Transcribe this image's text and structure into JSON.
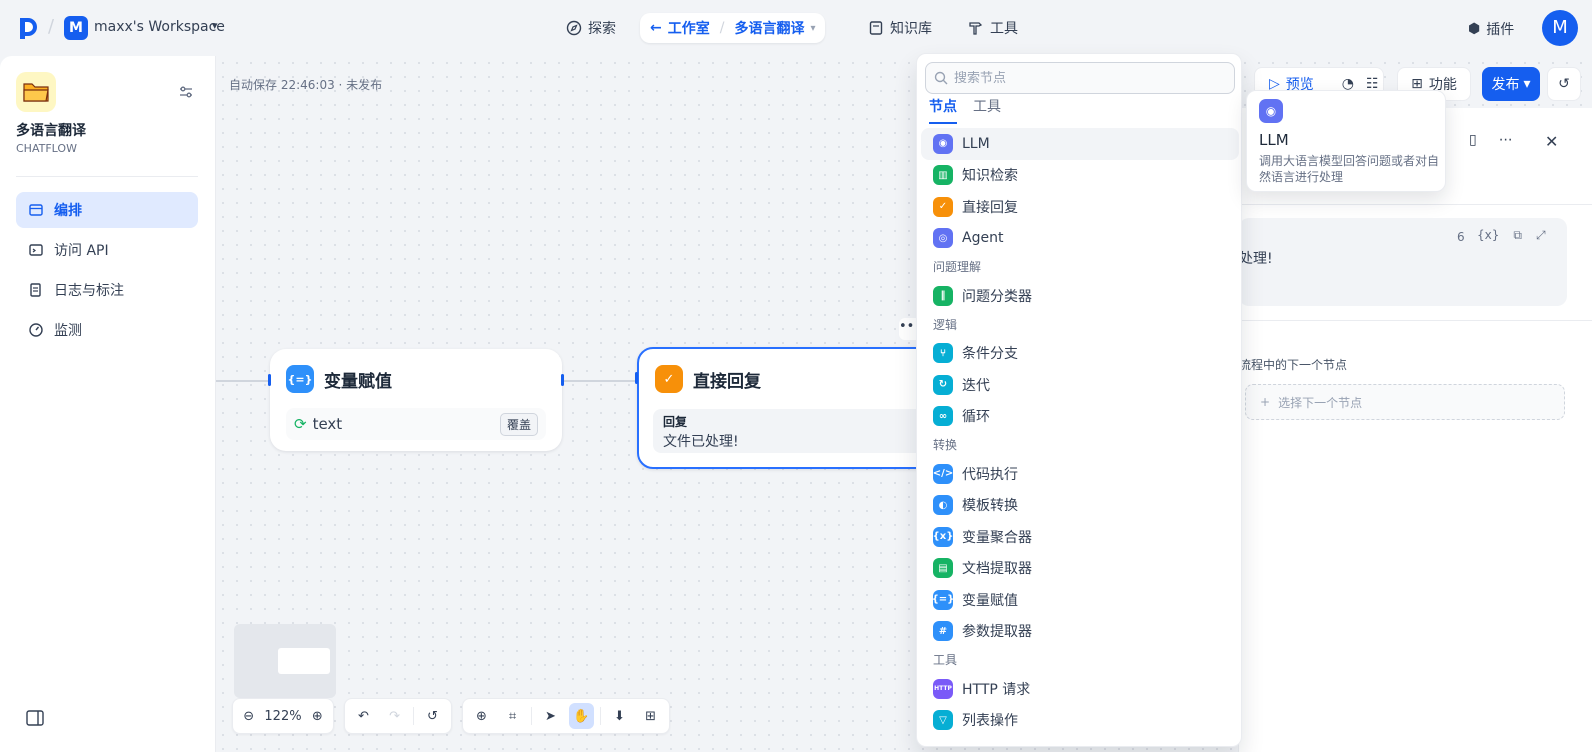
{
  "topbar": {
    "workspace_initial": "M",
    "workspace_name": "maxx's Workspace",
    "nav_explore": "探索",
    "nav_studio": "工作室",
    "nav_studio_app": "多语言翻译",
    "nav_knowledge": "知识库",
    "nav_tools": "工具",
    "plugin": "插件",
    "avatar_initial": "M"
  },
  "sidebar": {
    "app_name": "多语言翻译",
    "app_mode": "CHATFLOW",
    "items": [
      {
        "label": "编排",
        "icon": "layout-icon",
        "active": true
      },
      {
        "label": "访问 API",
        "icon": "terminal-icon",
        "active": false
      },
      {
        "label": "日志与标注",
        "icon": "file-list-icon",
        "active": false
      },
      {
        "label": "监测",
        "icon": "dashboard-icon",
        "active": false
      }
    ]
  },
  "canvas": {
    "autosave": "自动保存 22:46:03 · 未发布",
    "node_assigner": {
      "title": "变量赋值",
      "var": "text",
      "tag": "覆盖"
    },
    "node_reply": {
      "title": "直接回复",
      "label": "回复",
      "text": "文件已处理!"
    }
  },
  "toolbar": {
    "preview": "预览",
    "features": "功能",
    "publish": "发布"
  },
  "picker": {
    "search_placeholder": "搜索节点",
    "tabs": [
      "节点",
      "工具"
    ],
    "items_top": [
      {
        "label": "LLM",
        "color": "#6172f3",
        "glyph": "◉",
        "hl": true
      },
      {
        "label": "知识检索",
        "color": "#16b364",
        "glyph": "▥"
      },
      {
        "label": "直接回复",
        "color": "#f79009",
        "glyph": "✓"
      },
      {
        "label": "Agent",
        "color": "#6172f3",
        "glyph": "◎"
      }
    ],
    "group1": "问题理解",
    "items_g1": [
      {
        "label": "问题分类器",
        "color": "#16b364",
        "glyph": "‖"
      }
    ],
    "group2": "逻辑",
    "items_g2": [
      {
        "label": "条件分支",
        "color": "#06aed4",
        "glyph": "⑂"
      },
      {
        "label": "迭代",
        "color": "#06aed4",
        "glyph": "↻"
      },
      {
        "label": "循环",
        "color": "#06aed4",
        "glyph": "∞"
      }
    ],
    "group3": "转换",
    "items_g3": [
      {
        "label": "代码执行",
        "color": "#2e90fa",
        "glyph": "</>"
      },
      {
        "label": "模板转换",
        "color": "#2e90fa",
        "glyph": "◐"
      },
      {
        "label": "变量聚合器",
        "color": "#2e90fa",
        "glyph": "{x}"
      },
      {
        "label": "文档提取器",
        "color": "#16b364",
        "glyph": "▤"
      },
      {
        "label": "变量赋值",
        "color": "#2e90fa",
        "glyph": "{=}"
      },
      {
        "label": "参数提取器",
        "color": "#2e90fa",
        "glyph": "#"
      }
    ],
    "group4": "工具",
    "items_g4": [
      {
        "label": "HTTP 请求",
        "color": "#7a5af8",
        "glyph": "HTTP"
      },
      {
        "label": "列表操作",
        "color": "#06aed4",
        "glyph": "▽"
      }
    ]
  },
  "tooltip": {
    "title": "LLM",
    "desc": "调用大语言模型回答问题或者对自然语言进行处理"
  },
  "panel": {
    "char_count": "6",
    "reply_preview": "处理!",
    "next_label": "流程中的下一个节点",
    "next_button": "选择下一个节点"
  },
  "controls": {
    "zoom": "122%"
  }
}
